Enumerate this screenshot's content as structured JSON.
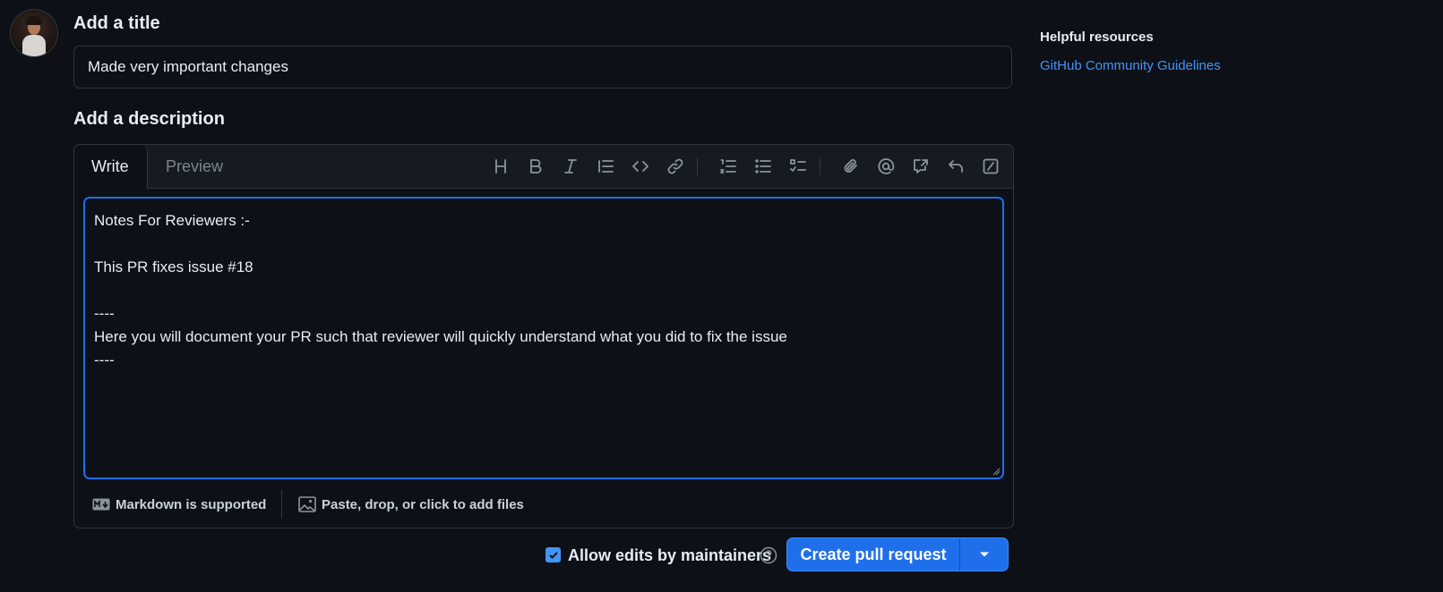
{
  "form": {
    "title_label": "Add a title",
    "title_value": "Made very important changes",
    "description_label": "Add a description"
  },
  "editor": {
    "tabs": [
      {
        "label": "Write",
        "active": true
      },
      {
        "label": "Preview",
        "active": false
      }
    ],
    "toolbar_icons": [
      "heading-icon",
      "bold-icon",
      "italic-icon",
      "quote-icon",
      "code-icon",
      "link-icon",
      "numbered-list-icon",
      "unordered-list-icon",
      "task-list-icon",
      "attach-icon",
      "mention-icon",
      "cross-reference-icon",
      "reply-icon",
      "slash-commands-icon"
    ],
    "body_lines": [
      "Notes For Reviewers :-",
      "",
      "This PR fixes issue #18",
      "",
      "----",
      "Here you will document your PR such that reviewer will quickly understand what you did to fix the issue",
      "----"
    ],
    "markdown_note": "Markdown is supported",
    "attach_note": "Paste, drop, or click to add files"
  },
  "actions": {
    "allow_edits_label": "Allow edits by maintainers",
    "allow_edits_checked": true,
    "create_label": "Create pull request"
  },
  "sidebar": {
    "heading": "Helpful resources",
    "link": "GitHub Community Guidelines"
  },
  "colors": {
    "background": "#0d1117",
    "border": "#30363d",
    "accent": "#1f6feb",
    "link": "#4493f8"
  }
}
